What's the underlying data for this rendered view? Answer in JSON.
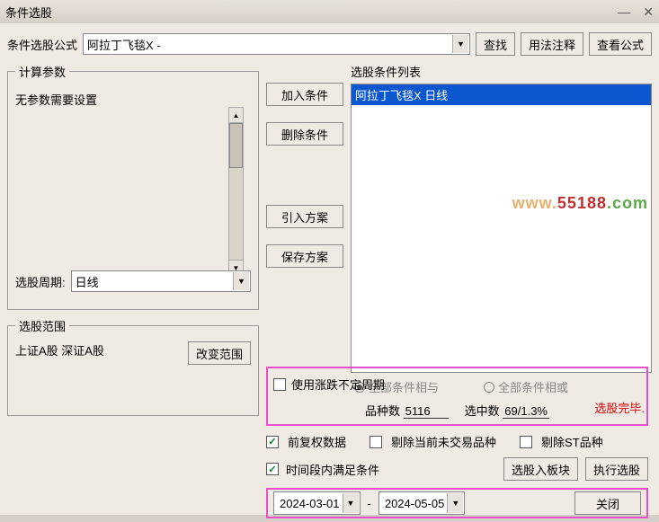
{
  "window": {
    "title": "条件选股"
  },
  "formula": {
    "label": "条件选股公式",
    "value": "阿拉丁飞毯X  -",
    "find": "查找",
    "usage": "用法注释",
    "view": "查看公式"
  },
  "params": {
    "group_title": "计算参数",
    "empty_msg": "无参数需要设置",
    "cycle_label": "选股周期:",
    "cycle_value": "日线"
  },
  "midbtns": {
    "add": "加入条件",
    "del": "删除条件",
    "import": "引入方案",
    "save": "保存方案"
  },
  "condlist": {
    "label": "选股条件列表",
    "items": [
      "阿拉丁飞毯X   日线"
    ],
    "radio_and": "全部条件相与",
    "radio_or": "全部条件相或",
    "status": "选股完毕."
  },
  "range": {
    "group_title": "选股范围",
    "text": "上证A股 深证A股",
    "change_btn": "改变范围"
  },
  "bottom": {
    "use_undef_cycle": "使用涨跌不定周期",
    "stats_variety_label": "品种数",
    "stats_variety_value": "5116",
    "stats_selected_label": "选中数",
    "stats_selected_value": "69/1.3%",
    "fqx": "前复权数据",
    "tchu_nontrade": "剔除当前未交易品种",
    "tchu_st": "剔除ST品种",
    "time_cond": "时间段内满足条件",
    "select_board": "选股入板块",
    "exec": "执行选股",
    "date_from": "2024-03-01",
    "date_sep": "-",
    "date_to": "2024-05-05",
    "close": "关闭"
  }
}
